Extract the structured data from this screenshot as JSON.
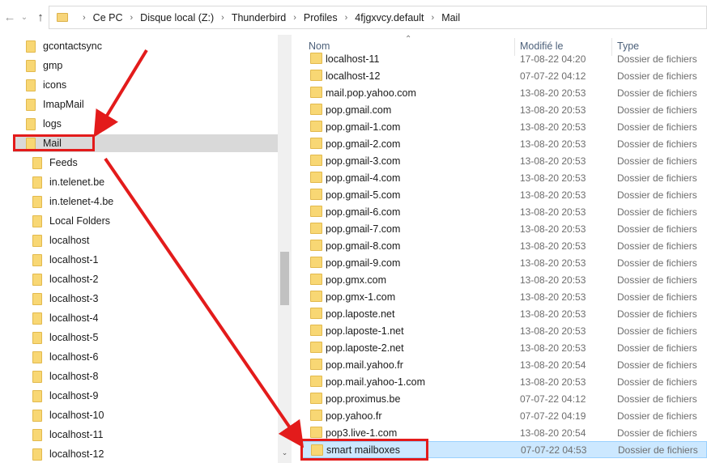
{
  "addressbar": {
    "breadcrumb": [
      "Ce PC",
      "Disque local (Z:)",
      "Thunderbird",
      "Profiles",
      "4fjgxvcy.default",
      "Mail"
    ]
  },
  "nav_buttons": {
    "back": "←",
    "forward": "→",
    "recent": "⌄",
    "up": "↑"
  },
  "nav_tree": [
    {
      "label": "gcontactsync",
      "level": 0
    },
    {
      "label": "gmp",
      "level": 0
    },
    {
      "label": "icons",
      "level": 0
    },
    {
      "label": "ImapMail",
      "level": 0
    },
    {
      "label": "logs",
      "level": 0
    },
    {
      "label": "Mail",
      "level": 0,
      "selected": true
    },
    {
      "label": "Feeds",
      "level": 1
    },
    {
      "label": "in.telenet.be",
      "level": 1
    },
    {
      "label": "in.telenet-4.be",
      "level": 1
    },
    {
      "label": "Local Folders",
      "level": 1
    },
    {
      "label": "localhost",
      "level": 1
    },
    {
      "label": "localhost-1",
      "level": 1
    },
    {
      "label": "localhost-2",
      "level": 1
    },
    {
      "label": "localhost-3",
      "level": 1
    },
    {
      "label": "localhost-4",
      "level": 1
    },
    {
      "label": "localhost-5",
      "level": 1
    },
    {
      "label": "localhost-6",
      "level": 1
    },
    {
      "label": "localhost-8",
      "level": 1
    },
    {
      "label": "localhost-9",
      "level": 1
    },
    {
      "label": "localhost-10",
      "level": 1
    },
    {
      "label": "localhost-11",
      "level": 1
    },
    {
      "label": "localhost-12",
      "level": 1
    }
  ],
  "columns": {
    "name": "Nom",
    "modified": "Modifié le",
    "type": "Type"
  },
  "files": [
    {
      "name": "localhost-11",
      "date": "17-08-22 04:20",
      "type": "Dossier de fichiers"
    },
    {
      "name": "localhost-12",
      "date": "07-07-22 04:12",
      "type": "Dossier de fichiers"
    },
    {
      "name": "mail.pop.yahoo.com",
      "date": "13-08-20 20:53",
      "type": "Dossier de fichiers"
    },
    {
      "name": "pop.gmail.com",
      "date": "13-08-20 20:53",
      "type": "Dossier de fichiers"
    },
    {
      "name": "pop.gmail-1.com",
      "date": "13-08-20 20:53",
      "type": "Dossier de fichiers"
    },
    {
      "name": "pop.gmail-2.com",
      "date": "13-08-20 20:53",
      "type": "Dossier de fichiers"
    },
    {
      "name": "pop.gmail-3.com",
      "date": "13-08-20 20:53",
      "type": "Dossier de fichiers"
    },
    {
      "name": "pop.gmail-4.com",
      "date": "13-08-20 20:53",
      "type": "Dossier de fichiers"
    },
    {
      "name": "pop.gmail-5.com",
      "date": "13-08-20 20:53",
      "type": "Dossier de fichiers"
    },
    {
      "name": "pop.gmail-6.com",
      "date": "13-08-20 20:53",
      "type": "Dossier de fichiers"
    },
    {
      "name": "pop.gmail-7.com",
      "date": "13-08-20 20:53",
      "type": "Dossier de fichiers"
    },
    {
      "name": "pop.gmail-8.com",
      "date": "13-08-20 20:53",
      "type": "Dossier de fichiers"
    },
    {
      "name": "pop.gmail-9.com",
      "date": "13-08-20 20:53",
      "type": "Dossier de fichiers"
    },
    {
      "name": "pop.gmx.com",
      "date": "13-08-20 20:53",
      "type": "Dossier de fichiers"
    },
    {
      "name": "pop.gmx-1.com",
      "date": "13-08-20 20:53",
      "type": "Dossier de fichiers"
    },
    {
      "name": "pop.laposte.net",
      "date": "13-08-20 20:53",
      "type": "Dossier de fichiers"
    },
    {
      "name": "pop.laposte-1.net",
      "date": "13-08-20 20:53",
      "type": "Dossier de fichiers"
    },
    {
      "name": "pop.laposte-2.net",
      "date": "13-08-20 20:53",
      "type": "Dossier de fichiers"
    },
    {
      "name": "pop.mail.yahoo.fr",
      "date": "13-08-20 20:54",
      "type": "Dossier de fichiers"
    },
    {
      "name": "pop.mail.yahoo-1.com",
      "date": "13-08-20 20:53",
      "type": "Dossier de fichiers"
    },
    {
      "name": "pop.proximus.be",
      "date": "07-07-22 04:12",
      "type": "Dossier de fichiers"
    },
    {
      "name": "pop.yahoo.fr",
      "date": "07-07-22 04:19",
      "type": "Dossier de fichiers"
    },
    {
      "name": "pop3.live-1.com",
      "date": "13-08-20 20:54",
      "type": "Dossier de fichiers"
    },
    {
      "name": "smart mailboxes",
      "date": "07-07-22 04:53",
      "type": "Dossier de fichiers",
      "selected": true
    }
  ],
  "colors": {
    "annotation": "#e31b1b",
    "selection": "#cce8ff",
    "folder": "#f8d774"
  }
}
